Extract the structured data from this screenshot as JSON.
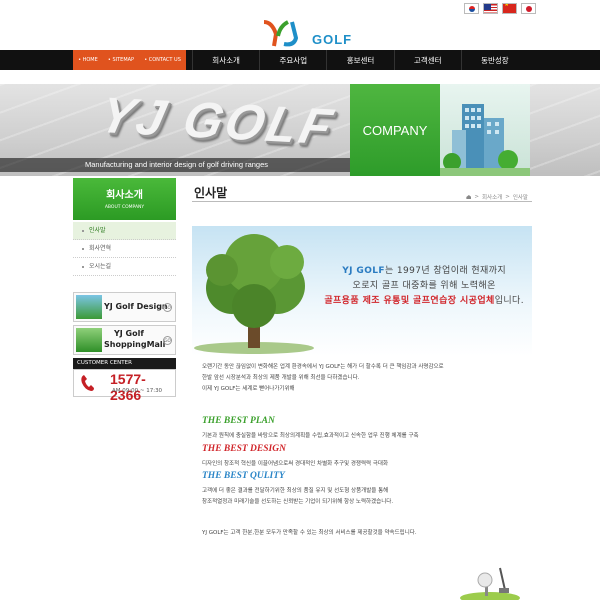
{
  "header": {
    "logo_text": "GOLF",
    "flags": [
      "kr-flag-icon",
      "us-flag-icon",
      "cn-flag-icon",
      "jp-flag-icon"
    ]
  },
  "nav": {
    "util": [
      "• HOME",
      "• SITEMAP",
      "• CONTACT US"
    ],
    "items": [
      "회사소개",
      "주요사업",
      "홍보센터",
      "고객센터",
      "동반성장"
    ]
  },
  "banner": {
    "big_logo": "YJ GOLF",
    "tagline": "Manufacturing and interior design of golf driving ranges",
    "company": "COMPANY"
  },
  "sidebar": {
    "title": "회사소개",
    "subtitle": "ABOUT COMPANY",
    "items": [
      "인사말",
      "회사연혁",
      "오시는길"
    ],
    "design_label": "YJ Golf Design",
    "mall_label_1": "YJ Golf",
    "mall_label_2": "ShoppingMall",
    "go": "GO",
    "customer_center": "CUSTOMER CENTER",
    "phone": "1577-2366",
    "hours": "AM 09:00 ~ 17:30"
  },
  "content": {
    "title": "인사말",
    "breadcrumb": [
      "회사소개",
      "인사말"
    ],
    "hero": {
      "line1_brand": "YJ GOLF",
      "line1_rest": "는 1997년 창업이래 현재까지",
      "line2": "오로지 골프 대중화를 위해 노력해온",
      "line3_highlight": "골프용품 제조 유통및 골프연습장 시공업체",
      "line3_rest": "입니다."
    },
    "intro": [
      "오랜기간 동안 끊임없이 변화해온 업계 환경속에서 YJ GOLF는 해가 더 할수록 더 큰 책임감과 사명감으로",
      "한발 앞선 시장분석과 최상의 제품 개발을 위해 최선을 다하겠습니다.",
      "이제 YJ GOLF는 세계로 뻗어나가기위해"
    ],
    "plan_title": "THE BEST PLAN",
    "plan_text": "기본과 원칙에 충실함을 바탕으로 최상의계획을 수립,효과적이고 신속한 업무 진행 체계를 구축",
    "design_title": "THE BEST DESIGN",
    "design_text": "디자인의 창조적 혁신을 이끌어냄으로써 경대적인 차별화 추구및 경쟁력력 극대화",
    "quality_title": "THE BEST QULITY",
    "quality_text_1": "고객에 더 좋은 결과를 전달하기위한 최상의 품질 유지 및 선도형 상품개발을 통해",
    "quality_text_2": "창조적열정과 미래기술을 선도하는 신뢰받는 기업이 되기위해 항상 노력하겠습니다.",
    "closing": "YJ GOLF는 고객 한분,한분 모두가 만족할 수 있는 최상의 서비스를 제공할것을 약속드립니다."
  },
  "colors": {
    "nav_bg": "#111111",
    "util_bg": "#e0531e",
    "green": "#3ba02c",
    "red": "#d1262b",
    "blue": "#2a85c7"
  }
}
